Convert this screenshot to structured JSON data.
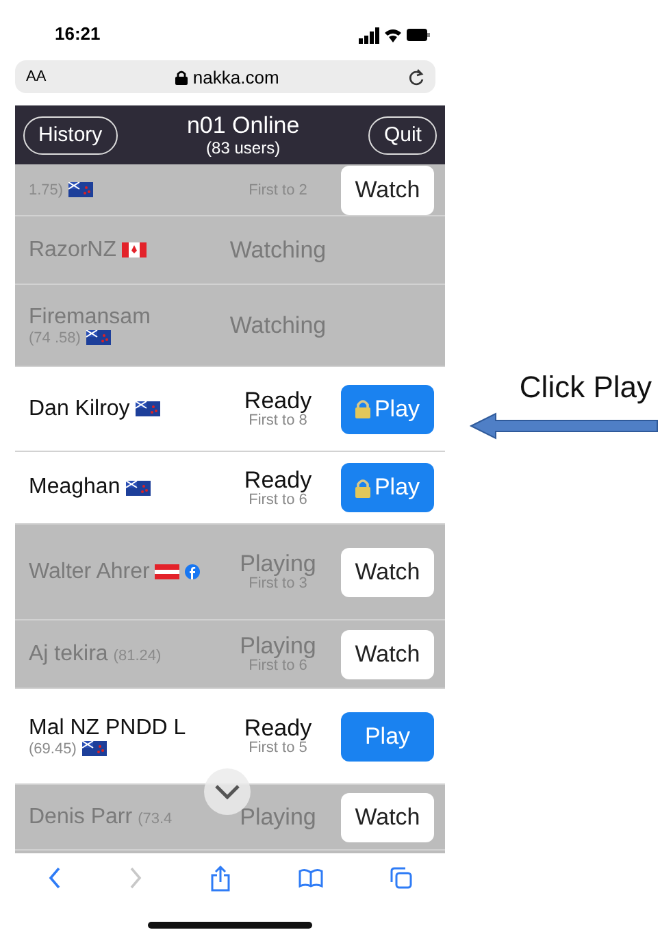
{
  "status_bar": {
    "time": "16:21"
  },
  "address_bar": {
    "text_size": "AA",
    "url": "nakka.com"
  },
  "header": {
    "left_button": "History",
    "title": "n01 Online",
    "subtitle": "(83 users)",
    "right_button": "Quit"
  },
  "players": [
    {
      "rating": "1.75)",
      "flags": [
        {
          "kind": "nz"
        }
      ],
      "active": false,
      "first_to": "First to 2",
      "button": {
        "kind": "watch",
        "label": "Watch",
        "locked": false
      }
    },
    {
      "name": "RazorNZ",
      "flags": [
        {
          "kind": "ca"
        }
      ],
      "active": false,
      "status": "Watching"
    },
    {
      "name": "Firemansam",
      "rating": "(74 .58)",
      "flags": [
        {
          "kind": "nz"
        }
      ],
      "active": false,
      "status": "Watching"
    },
    {
      "name": "Dan Kilroy",
      "flags": [
        {
          "kind": "nz"
        }
      ],
      "active": true,
      "status": "Ready",
      "first_to": "First to 8",
      "button": {
        "kind": "play",
        "label": "Play",
        "locked": true
      }
    },
    {
      "name": "Meaghan",
      "flags": [
        {
          "kind": "nz"
        }
      ],
      "active": true,
      "status": "Ready",
      "first_to": "First to 6",
      "button": {
        "kind": "play",
        "label": "Play",
        "locked": true
      }
    },
    {
      "name": "Walter Ahrer",
      "flags": [
        {
          "kind": "at"
        },
        {
          "kind": "facebook"
        }
      ],
      "active": false,
      "status": "Playing",
      "first_to": "First to 3",
      "button": {
        "kind": "watch",
        "label": "Watch",
        "locked": false
      }
    },
    {
      "name": "Aj tekira",
      "rating": "(81.24)",
      "active": false,
      "status": "Playing",
      "first_to": "First to 6",
      "button": {
        "kind": "watch",
        "label": "Watch",
        "locked": false
      }
    },
    {
      "name": "Mal NZ PNDD L",
      "rating": "(69.45)",
      "flags": [
        {
          "kind": "nz"
        }
      ],
      "active": true,
      "status": "Ready",
      "first_to": "First to 5",
      "button": {
        "kind": "play",
        "label": "Play",
        "locked": false
      }
    },
    {
      "name": "Denis Parr",
      "rating": "(73.4",
      "active": false,
      "status": "Playing",
      "button": {
        "kind": "watch",
        "label": "Watch",
        "locked": false
      }
    }
  ],
  "annotation": {
    "text": "Click Play"
  }
}
